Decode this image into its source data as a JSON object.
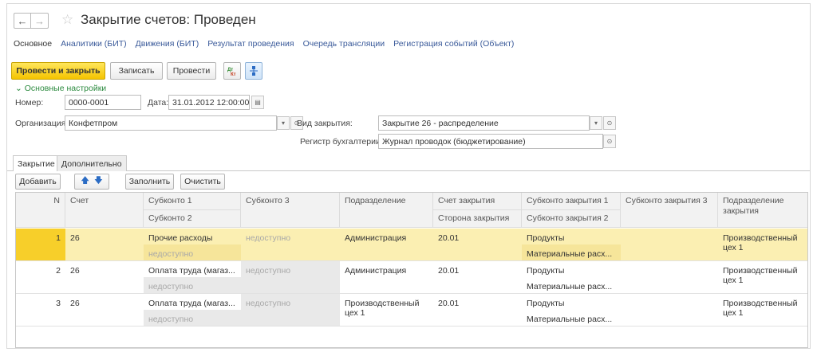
{
  "window": {
    "title": "Закрытие счетов: Проведен"
  },
  "nav_links": [
    {
      "label": "Основное",
      "active": true
    },
    {
      "label": "Аналитики (БИТ)"
    },
    {
      "label": "Движения (БИТ)"
    },
    {
      "label": "Результат проведения"
    },
    {
      "label": "Очередь трансляции"
    },
    {
      "label": "Регистрация событий (Объект)"
    }
  ],
  "toolbar": {
    "post_close": "Провести и закрыть",
    "save": "Записать",
    "post": "Провести",
    "icon1": "dt-kt-icon",
    "icon2": "structure-icon"
  },
  "form": {
    "section_title": "Основные настройки",
    "number_label": "Номер:",
    "number_value": "0000-0001",
    "date_label": "Дата:",
    "date_value": "31.01.2012 12:00:00",
    "org_label": "Организация:",
    "org_value": "Конфетпром",
    "closing_type_label": "Вид закрытия:",
    "closing_type_value": "Закрытие 26 - распределение",
    "register_label": "Регистр бухгалтерии:",
    "register_value": "Журнал проводок (бюджетирование)"
  },
  "tabs": [
    {
      "label": "Закрытие",
      "active": true
    },
    {
      "label": "Дополнительно"
    }
  ],
  "table_toolbar": {
    "add": "Добавить",
    "fill": "Заполнить",
    "clear": "Очистить"
  },
  "table": {
    "headers": {
      "n": "N",
      "account": "Счет",
      "subconto1": "Субконто 1",
      "subconto2": "Субконто 2",
      "subconto3": "Субконто 3",
      "department": "Подразделение",
      "closing_account": "Счет закрытия",
      "closing_side": "Сторона закрытия",
      "closing_sub1": "Субконто закрытия 1",
      "closing_sub2": "Субконто закрытия 2",
      "closing_sub3": "Субконто закрытия 3",
      "closing_dept": "Подразделение закрытия"
    },
    "rows": [
      {
        "n": "1",
        "account": "26",
        "subconto1": "Прочие расходы",
        "subconto2": "недоступно",
        "subconto3": "недоступно",
        "department": "Администрация",
        "closing_account": "20.01",
        "closing_sub1": "Продукты",
        "closing_sub2": "Материальные расх...",
        "closing_dept": "Производственный цех 1"
      },
      {
        "n": "2",
        "account": "26",
        "subconto1": "Оплата труда (магаз...",
        "subconto2": "недоступно",
        "subconto3": "недоступно",
        "department": "Администрация",
        "closing_account": "20.01",
        "closing_sub1": "Продукты",
        "closing_sub2": "Материальные расх...",
        "closing_dept": "Производственный цех 1"
      },
      {
        "n": "3",
        "account": "26",
        "subconto1": "Оплата труда (магаз...",
        "subconto2": "недоступно",
        "subconto3": "недоступно",
        "department": "Производственный цех 1",
        "closing_account": "20.01",
        "closing_sub1": "Продукты",
        "closing_sub2": "Материальные расх...",
        "closing_dept": "Производственный цех 1"
      }
    ]
  }
}
